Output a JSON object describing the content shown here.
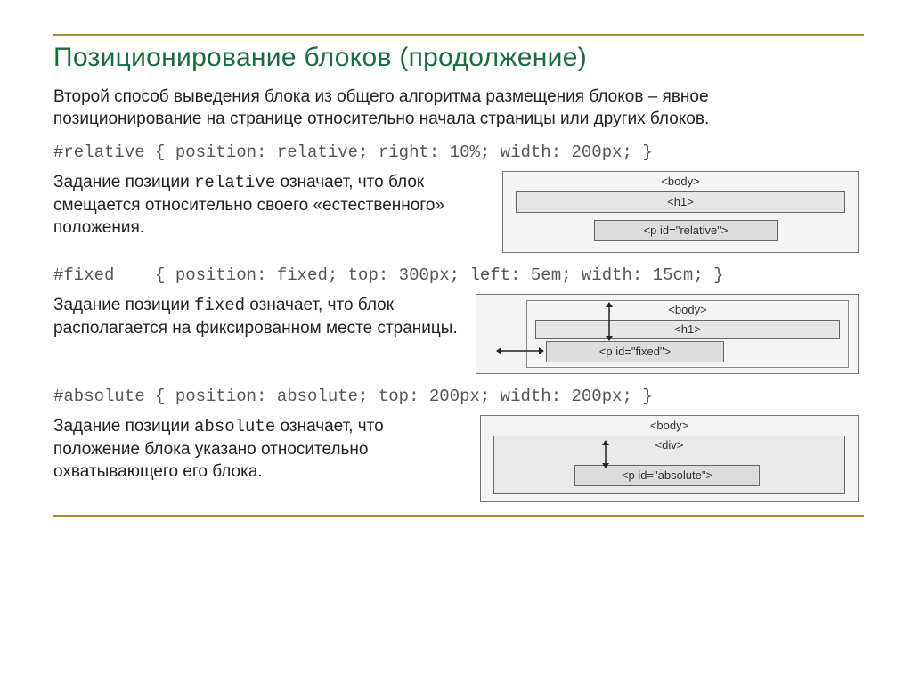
{
  "title": "Позиционирование блоков (продолжение)",
  "intro": "Второй способ выведения блока из общего алгоритма размещения блоков – явное позиционирование на странице относительно начала страницы или других блоков.",
  "sections": {
    "relative": {
      "code": "#relative { position: relative; right: 10%; width: 200px; }",
      "desc_pre": "Задание позиции ",
      "desc_kw": "relative",
      "desc_post": " означает, что блок смещается относительно своего «естественного» положения.",
      "diagram": {
        "body": "<body>",
        "h1": "<h1>",
        "p": "<p id=\"relative\">"
      }
    },
    "fixed": {
      "code": "#fixed    { position: fixed; top: 300px; left: 5em; width: 15cm; }",
      "desc_pre": "Задание позиции ",
      "desc_kw": "fixed",
      "desc_post": " означает, что блок располагается на фиксированном месте страницы.",
      "diagram": {
        "body": "<body>",
        "h1": "<h1>",
        "p": "<p id=\"fixed\">"
      }
    },
    "absolute": {
      "code": "#absolute { position: absolute; top: 200px; width: 200px; }",
      "desc_pre": "Задание позиции ",
      "desc_kw": "absolute",
      "desc_post": " означает, что положение блока указано относительно охватывающего его блока.",
      "diagram": {
        "body": "<body>",
        "div": "<div>",
        "p": "<p id=\"absolute\">"
      }
    }
  }
}
